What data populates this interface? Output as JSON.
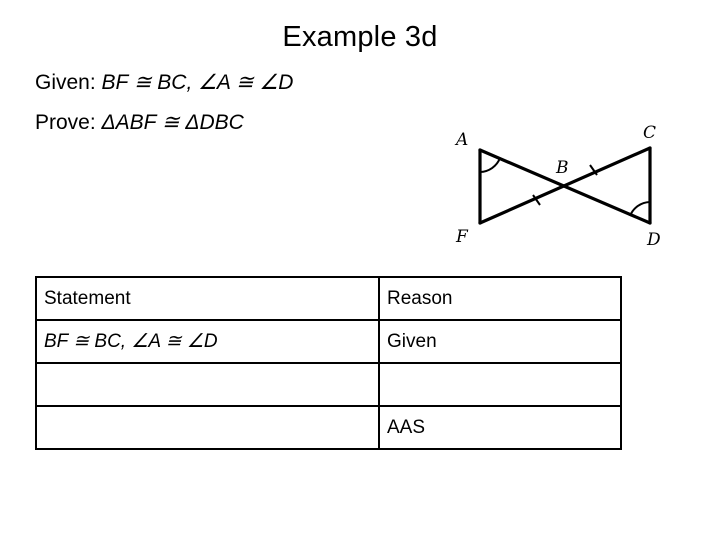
{
  "slide": {
    "title": "Example 3d",
    "background_color": "#ffffff",
    "text_color": "#000000"
  },
  "premises": {
    "given_label": "Given:",
    "given_statement": "BF ≅ BC,  ∠A ≅ ∠D",
    "prove_label": "Prove:",
    "prove_statement": "ΔABF ≅ ΔDBC"
  },
  "figure": {
    "name": "bowtie-triangles-diagram",
    "vertex_labels": [
      "A",
      "C",
      "B",
      "F",
      "D"
    ],
    "description": "Two triangles ABF and DBC meeting at point B forming a bowtie",
    "tick_marks": 2,
    "angle_arcs": 2,
    "stroke_color": "#000000"
  },
  "proof_table": {
    "headers": [
      "Statement",
      "Reason"
    ],
    "rows": [
      {
        "statement": "BF ≅ BC,  ∠A ≅ ∠D",
        "reason": "Given"
      },
      {
        "statement": "",
        "reason": ""
      },
      {
        "statement": "",
        "reason": "AAS"
      }
    ]
  }
}
